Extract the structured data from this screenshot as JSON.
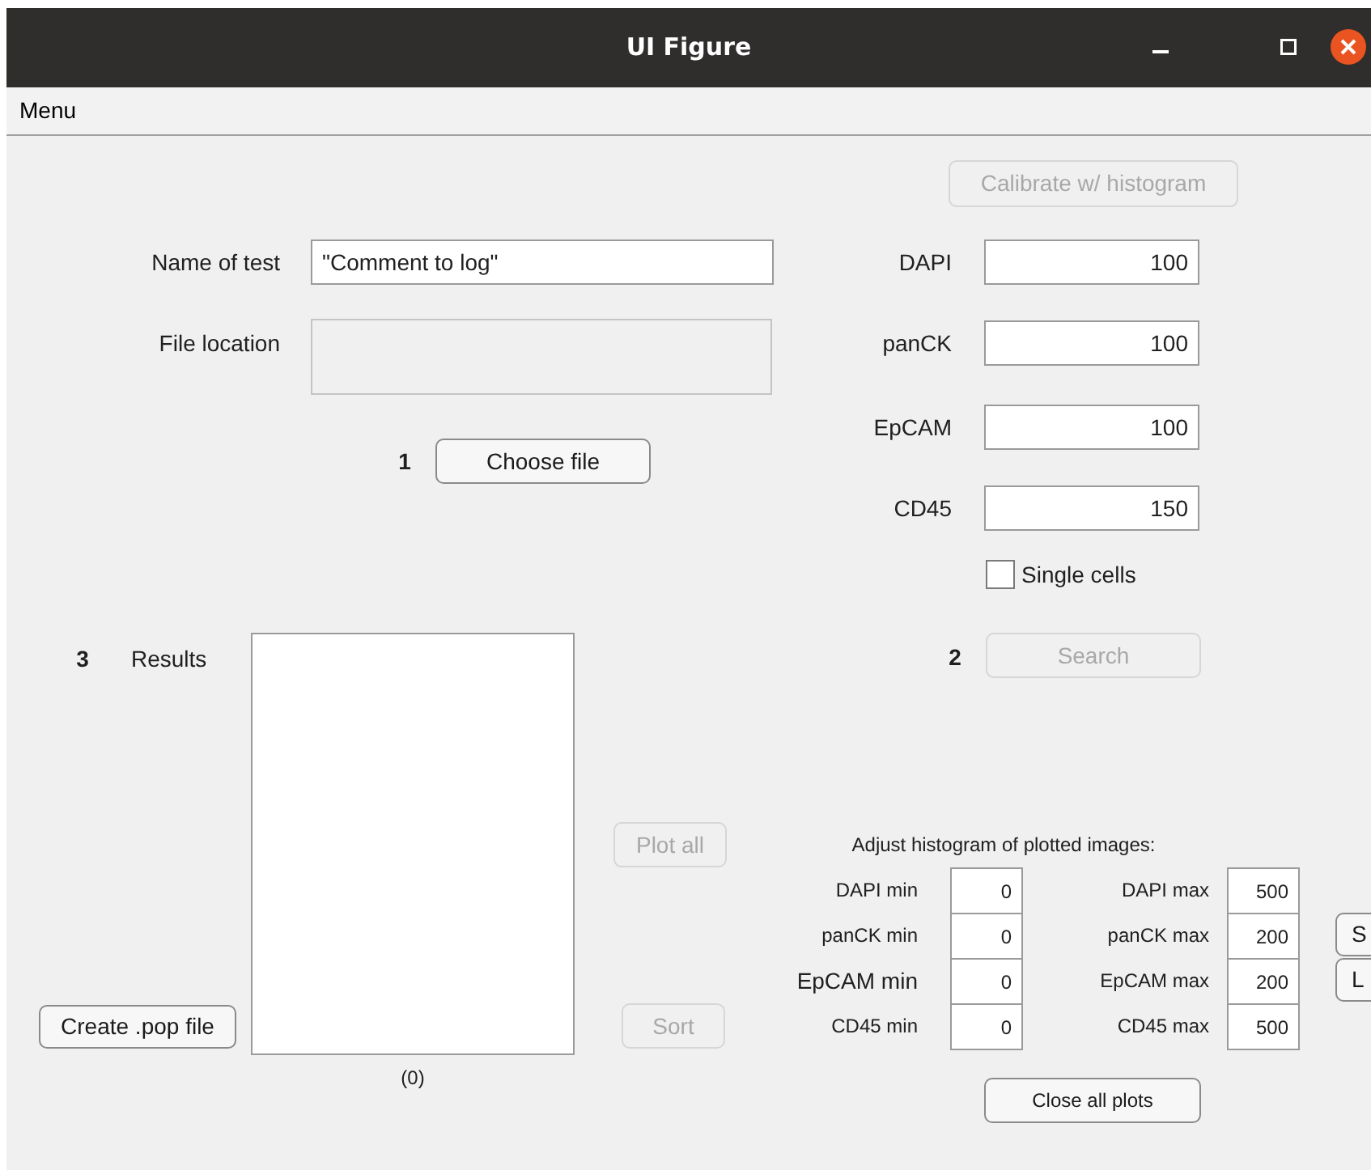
{
  "window": {
    "title": "UI Figure"
  },
  "menu": [
    "Menu"
  ],
  "calibrate_button": {
    "label": "Calibrate w/ histogram",
    "disabled": true
  },
  "name_of_test": {
    "label": "Name of test",
    "value": "\"Comment to log\""
  },
  "file_location": {
    "label": "File location",
    "disabled": true
  },
  "step_1": {
    "number": "1",
    "button": {
      "label": "Choose file",
      "disabled": false
    }
  },
  "thresholds": [
    {
      "label": "DAPI",
      "value": "100"
    },
    {
      "label": "panCK",
      "value": "100"
    },
    {
      "label": "EpCAM",
      "value": "100"
    },
    {
      "label": "CD45",
      "value": "150"
    }
  ],
  "single_cells": {
    "label": "Single cells",
    "checked": false
  },
  "step_2": {
    "number": "2",
    "button": {
      "label": "Search",
      "disabled": true
    }
  },
  "step_3": {
    "number": "3",
    "label": "Results",
    "count": "(0)"
  },
  "plot_all_button": {
    "label": "Plot all",
    "disabled": true
  },
  "sort_button": {
    "label": "Sort",
    "disabled": true
  },
  "create_pop_button": {
    "label": "Create .pop file",
    "disabled": false
  },
  "histogram": {
    "title": "Adjust histogram of plotted images:",
    "rows": [
      {
        "min_label": "DAPI min",
        "min": "0",
        "max_label": "DAPI max",
        "max": "500"
      },
      {
        "min_label": "panCK min",
        "min": "0",
        "max_label": "panCK max",
        "max": "200"
      },
      {
        "min_label": "EpCAM min",
        "min": "0",
        "max_label": "EpCAM max",
        "max": "200"
      },
      {
        "min_label": "CD45 min",
        "min": "0",
        "max_label": "CD45 max",
        "max": "500"
      }
    ],
    "close_button": {
      "label": "Close all plots",
      "disabled": false
    }
  },
  "side_buttons": [
    {
      "label": "S"
    },
    {
      "label": "L"
    }
  ]
}
